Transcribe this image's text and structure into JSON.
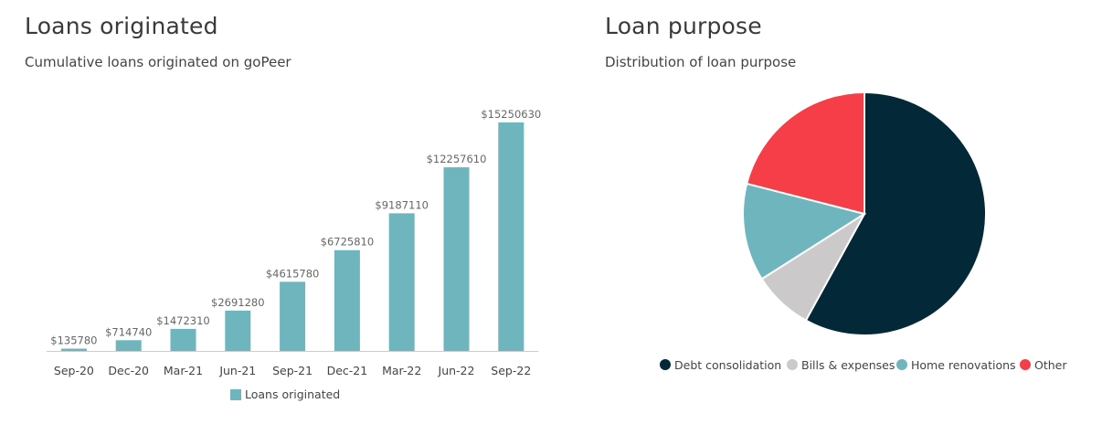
{
  "charts": {
    "loans": {
      "title": "Loans originated",
      "subtitle": "Cumulative loans originated on goPeer"
    },
    "purpose": {
      "title": "Loan purpose",
      "subtitle": "Distribution of loan purpose"
    }
  },
  "chart_data": [
    {
      "type": "bar",
      "title": "Loans originated",
      "subtitle": "Cumulative loans originated on goPeer",
      "categories": [
        "Sep-20",
        "Dec-20",
        "Mar-21",
        "Jun-21",
        "Sep-21",
        "Dec-21",
        "Mar-22",
        "Jun-22",
        "Sep-22"
      ],
      "series": [
        {
          "name": "Loans originated",
          "values": [
            135780,
            714740,
            1472310,
            2691280,
            4615780,
            6725810,
            9187110,
            12257610,
            15250630
          ],
          "labels": [
            "$135780",
            "$714740",
            "$1472310",
            "$2691280",
            "$4615780",
            "$6725810",
            "$9187110",
            "$12257610",
            "$15250630"
          ],
          "color": "#6fb5bd"
        }
      ],
      "ylim": [
        0,
        15250630
      ],
      "grid": false,
      "legend": "bottom"
    },
    {
      "type": "pie",
      "title": "Loan purpose",
      "subtitle": "Distribution of loan purpose",
      "slices": [
        {
          "label": "Debt consolidation",
          "value": 58,
          "color": "#032838"
        },
        {
          "label": "Bills & expenses",
          "value": 8,
          "color": "#cbc9c9"
        },
        {
          "label": "Home renovations",
          "value": 13,
          "color": "#6fb5bd"
        },
        {
          "label": "Other",
          "value": 21,
          "color": "#f53e47"
        }
      ],
      "legend": "bottom"
    }
  ]
}
